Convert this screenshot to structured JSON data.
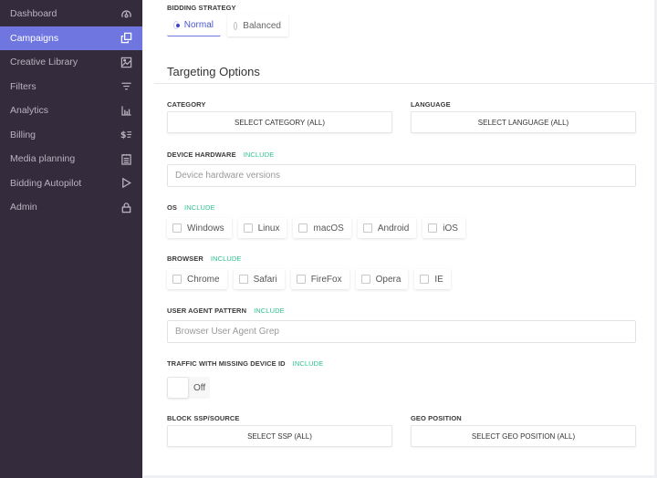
{
  "sidebar": {
    "items": [
      {
        "label": "Dashboard",
        "icon": "dashboard-icon",
        "active": false
      },
      {
        "label": "Campaigns",
        "icon": "copy-icon",
        "active": true
      },
      {
        "label": "Creative Library",
        "icon": "image-icon",
        "active": false
      },
      {
        "label": "Filters",
        "icon": "filter-icon",
        "active": false
      },
      {
        "label": "Analytics",
        "icon": "bar-chart-icon",
        "active": false
      },
      {
        "label": "Billing",
        "icon": "dollar-list-icon",
        "active": false
      },
      {
        "label": "Media planning",
        "icon": "notepad-icon",
        "active": false
      },
      {
        "label": "Bidding Autopilot",
        "icon": "play-icon",
        "active": false
      },
      {
        "label": "Admin",
        "icon": "lock-icon",
        "active": false
      }
    ]
  },
  "colors": {
    "sidebar_bg": "#342c3d",
    "active_bg": "#6f76e0",
    "include_green": "#2ec091",
    "radio_selected": "#3c44c8"
  },
  "bidding_strategy": {
    "label": "BIDDING STRATEGY",
    "options": [
      {
        "label": "Normal",
        "selected": true
      },
      {
        "label": "Balanced",
        "selected": false
      }
    ]
  },
  "targeting": {
    "title": "Targeting Options",
    "include_label": "INCLUDE",
    "category": {
      "label": "CATEGORY",
      "button": "SELECT CATEGORY (ALL)"
    },
    "language": {
      "label": "LANGUAGE",
      "button": "SELECT LANGUAGE (ALL)"
    },
    "device_hardware": {
      "label": "DEVICE HARDWARE",
      "placeholder": "Device hardware versions",
      "value": ""
    },
    "os": {
      "label": "OS",
      "options": [
        {
          "label": "Windows",
          "checked": false
        },
        {
          "label": "Linux",
          "checked": false
        },
        {
          "label": "macOS",
          "checked": false
        },
        {
          "label": "Android",
          "checked": false
        },
        {
          "label": "iOS",
          "checked": false
        }
      ]
    },
    "browser": {
      "label": "BROWSER",
      "options": [
        {
          "label": "Chrome",
          "checked": false
        },
        {
          "label": "Safari",
          "checked": false
        },
        {
          "label": "FireFox",
          "checked": false
        },
        {
          "label": "Opera",
          "checked": false
        },
        {
          "label": "IE",
          "checked": false
        }
      ]
    },
    "user_agent": {
      "label": "USER AGENT PATTERN",
      "placeholder": "Browser User Agent Grep",
      "value": ""
    },
    "missing_device_id": {
      "label": "TRAFFIC WITH MISSING DEVICE ID",
      "state": "Off"
    },
    "block_ssp": {
      "label": "BLOCK SSP/SOURCE",
      "button": "SELECT SSP (ALL)"
    },
    "geo_position": {
      "label": "GEO POSITION",
      "button": "SELECT GEO POSITION (ALL)"
    }
  }
}
